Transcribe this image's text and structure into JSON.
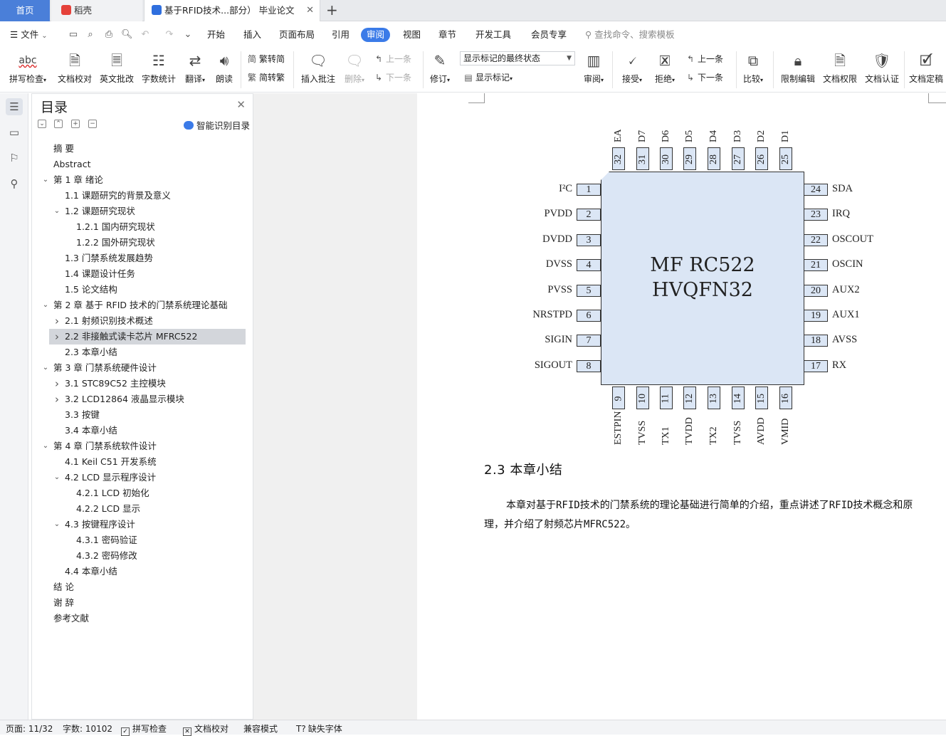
{
  "tabs": {
    "home": "首页",
    "daoke": "稻壳",
    "doc": "基于RFID技术...部分）  毕业论文",
    "close": "✕",
    "add": "+"
  },
  "menu": {
    "file": "文件",
    "file_caret": "⌄",
    "items": [
      "开始",
      "插入",
      "页面布局",
      "引用",
      "审阅",
      "视图",
      "章节",
      "开发工具",
      "会员专享"
    ],
    "active": "审阅",
    "search_placeholder": "查找命令、搜索模板"
  },
  "ribbon": {
    "spell_check": "拼写检查",
    "doc_proof": "文档校对",
    "en_review": "英文批改",
    "word_count": "字数统计",
    "translate": "翻译",
    "read_aloud": "朗读",
    "trad_to_simp": "繁转简",
    "simp_to_trad": "简转繁",
    "insert_comment": "插入批注",
    "delete": "删除",
    "prev": "上一条",
    "next": "下一条",
    "revise": "修订",
    "markup_state": "显示标记的最终状态",
    "show_markup": "显示标记",
    "review": "审阅",
    "accept": "接受",
    "reject": "拒绝",
    "prev2": "上一条",
    "next2": "下一条",
    "compare": "比较",
    "restrict_edit": "限制编辑",
    "doc_permission": "文档权限",
    "doc_cert": "文档认证",
    "doc_final": "文档定稿",
    "icon_abc": "abc"
  },
  "toc": {
    "title": "目录",
    "close": "✕",
    "smart": "智能识别目录",
    "items": [
      {
        "label": "摘  要",
        "level": 0,
        "arrow": ""
      },
      {
        "label": "Abstract",
        "level": 0,
        "arrow": ""
      },
      {
        "label": "第 1 章  绪论",
        "level": 0,
        "arrow": "down"
      },
      {
        "label": "1.1  课题研究的背景及意义",
        "level": 1,
        "arrow": ""
      },
      {
        "label": "1.2  课题研究现状",
        "level": 1,
        "arrow": "down"
      },
      {
        "label": "1.2.1  国内研究现状",
        "level": 2,
        "arrow": ""
      },
      {
        "label": "1.2.2  国外研究现状",
        "level": 2,
        "arrow": ""
      },
      {
        "label": "1.3  门禁系统发展趋势",
        "level": 1,
        "arrow": ""
      },
      {
        "label": "1.4  课题设计任务",
        "level": 1,
        "arrow": ""
      },
      {
        "label": "1.5  论文结构",
        "level": 1,
        "arrow": ""
      },
      {
        "label": "第 2 章  基于 RFID 技术的门禁系统理论基础",
        "level": 0,
        "arrow": "down"
      },
      {
        "label": "2.1  射频识别技术概述",
        "level": 1,
        "arrow": "right"
      },
      {
        "label": "2.2  非接触式读卡芯片 MFRC522",
        "level": 1,
        "arrow": "right",
        "selected": true
      },
      {
        "label": "2.3  本章小结",
        "level": 1,
        "arrow": ""
      },
      {
        "label": "第 3 章  门禁系统硬件设计",
        "level": 0,
        "arrow": "down"
      },
      {
        "label": "3.1 STC89C52 主控模块",
        "level": 1,
        "arrow": "right"
      },
      {
        "label": "3.2 LCD12864 液晶显示模块",
        "level": 1,
        "arrow": "right"
      },
      {
        "label": "3.3  按键",
        "level": 1,
        "arrow": ""
      },
      {
        "label": "3.4  本章小结",
        "level": 1,
        "arrow": ""
      },
      {
        "label": "第 4 章  门禁系统软件设计",
        "level": 0,
        "arrow": "down"
      },
      {
        "label": "4.1 Keil  C51 开发系统",
        "level": 1,
        "arrow": ""
      },
      {
        "label": "4.2 LCD 显示程序设计",
        "level": 1,
        "arrow": "down"
      },
      {
        "label": "4.2.1 LCD 初始化",
        "level": 2,
        "arrow": ""
      },
      {
        "label": "4.2.2 LCD 显示",
        "level": 2,
        "arrow": ""
      },
      {
        "label": "4.3 按键程序设计",
        "level": 1,
        "arrow": "down"
      },
      {
        "label": "4.3.1  密码验证",
        "level": 2,
        "arrow": ""
      },
      {
        "label": "4.3.2  密码修改",
        "level": 2,
        "arrow": ""
      },
      {
        "label": "4.4 本章小结",
        "level": 1,
        "arrow": ""
      },
      {
        "label": "结  论",
        "level": 0,
        "arrow": ""
      },
      {
        "label": "谢  辞",
        "level": 0,
        "arrow": ""
      },
      {
        "label": "参考文献",
        "level": 0,
        "arrow": ""
      }
    ]
  },
  "chip": {
    "name_line1": "MF RC522",
    "name_line2": "HVQFN32",
    "left_pins": [
      {
        "num": "1",
        "name": "I²C"
      },
      {
        "num": "2",
        "name": "PVDD"
      },
      {
        "num": "3",
        "name": "DVDD"
      },
      {
        "num": "4",
        "name": "DVSS"
      },
      {
        "num": "5",
        "name": "PVSS"
      },
      {
        "num": "6",
        "name": "NRSTPD"
      },
      {
        "num": "7",
        "name": "SIGIN"
      },
      {
        "num": "8",
        "name": "SIGOUT"
      }
    ],
    "right_pins": [
      {
        "num": "24",
        "name": "SDA"
      },
      {
        "num": "23",
        "name": "IRQ"
      },
      {
        "num": "22",
        "name": "OSCOUT"
      },
      {
        "num": "21",
        "name": "OSCIN"
      },
      {
        "num": "20",
        "name": "AUX2"
      },
      {
        "num": "19",
        "name": "AUX1"
      },
      {
        "num": "18",
        "name": "AVSS"
      },
      {
        "num": "17",
        "name": "RX"
      }
    ],
    "top_pins": [
      {
        "num": "32",
        "name": "EA"
      },
      {
        "num": "31",
        "name": "D7"
      },
      {
        "num": "30",
        "name": "D6"
      },
      {
        "num": "29",
        "name": "D5"
      },
      {
        "num": "28",
        "name": "D4"
      },
      {
        "num": "27",
        "name": "D3"
      },
      {
        "num": "26",
        "name": "D2"
      },
      {
        "num": "25",
        "name": "D1"
      }
    ],
    "bottom_pins": [
      {
        "num": "9",
        "name": "ESTPIN"
      },
      {
        "num": "10",
        "name": "TVSS"
      },
      {
        "num": "11",
        "name": "TX1"
      },
      {
        "num": "12",
        "name": "TVDD"
      },
      {
        "num": "13",
        "name": "TX2"
      },
      {
        "num": "14",
        "name": "TVSS"
      },
      {
        "num": "15",
        "name": "AVDD"
      },
      {
        "num": "16",
        "name": "VMID"
      }
    ]
  },
  "document": {
    "heading": "2.3  本章小结",
    "paragraph": "本章对基于RFID技术的门禁系统的理论基础进行简单的介绍，重点讲述了RFID技术概念和原理，并介绍了射频芯片MFRC522。"
  },
  "status": {
    "page": "页面: 11/32",
    "words": "字数: 10102",
    "spell": "拼写检查",
    "proof": "文档校对",
    "compat": "兼容模式",
    "missing_font": "缺失字体"
  },
  "colors": {
    "accent": "#3b7be8",
    "chip_fill": "#dbe6f5",
    "selected_row": "#d3d6db"
  }
}
